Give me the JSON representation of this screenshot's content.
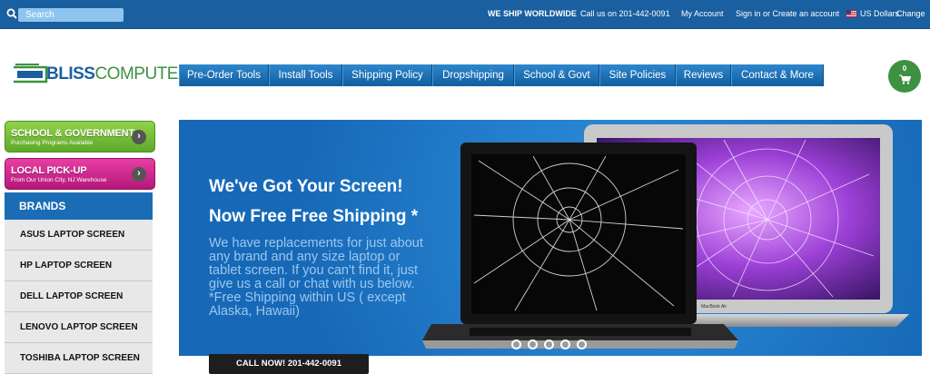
{
  "topbar": {
    "search_placeholder": "Search",
    "ship_worldwide": "WE SHIP WORLDWIDE",
    "call_us": "Call us on 201-442-0091",
    "my_account": "My Account",
    "sign_in": "Sign in or Create an account",
    "currency": "US Dollars",
    "change": "Change"
  },
  "logo": {
    "bliss": "BLISS",
    "computers": "COMPUTERS"
  },
  "nav": {
    "items": [
      "Pre-Order Tools",
      "Install Tools",
      "Shipping Policy",
      "Dropshipping",
      "School & Govt",
      "Site Policies",
      "Reviews",
      "Contact & More"
    ]
  },
  "cart": {
    "count": "0"
  },
  "promos": {
    "school": {
      "title": "SCHOOL & GOVERNMENT",
      "subtitle": "Purchasing Programs Available"
    },
    "pickup": {
      "title": "LOCAL PICK-UP",
      "subtitle": "From Our Union City, NJ Warehouse"
    }
  },
  "brands": {
    "header": "BRANDS",
    "items": [
      "ASUS LAPTOP SCREEN",
      "HP LAPTOP SCREEN",
      "DELL LAPTOP SCREEN",
      "LENOVO LAPTOP SCREEN",
      "TOSHIBA LAPTOP SCREEN"
    ]
  },
  "banner": {
    "headline1": "We've Got Your Screen!",
    "headline2": "Now Free Free Shipping *",
    "body": "We have replacements for just about any brand and any size laptop or tablet screen. If you can't find it, just give us a call or chat with us below. *Free Shipping within US ( except Alaska, Hawaii)",
    "call_button": "CALL NOW! 201-442-0091",
    "laptop_label": "MacBook Air",
    "slides": 5,
    "active_slide": 1
  },
  "colors": {
    "brand_blue": "#1a5fa0",
    "brand_green": "#3d9140",
    "promo_green": "#7cc23a",
    "promo_pink": "#d42b92"
  }
}
